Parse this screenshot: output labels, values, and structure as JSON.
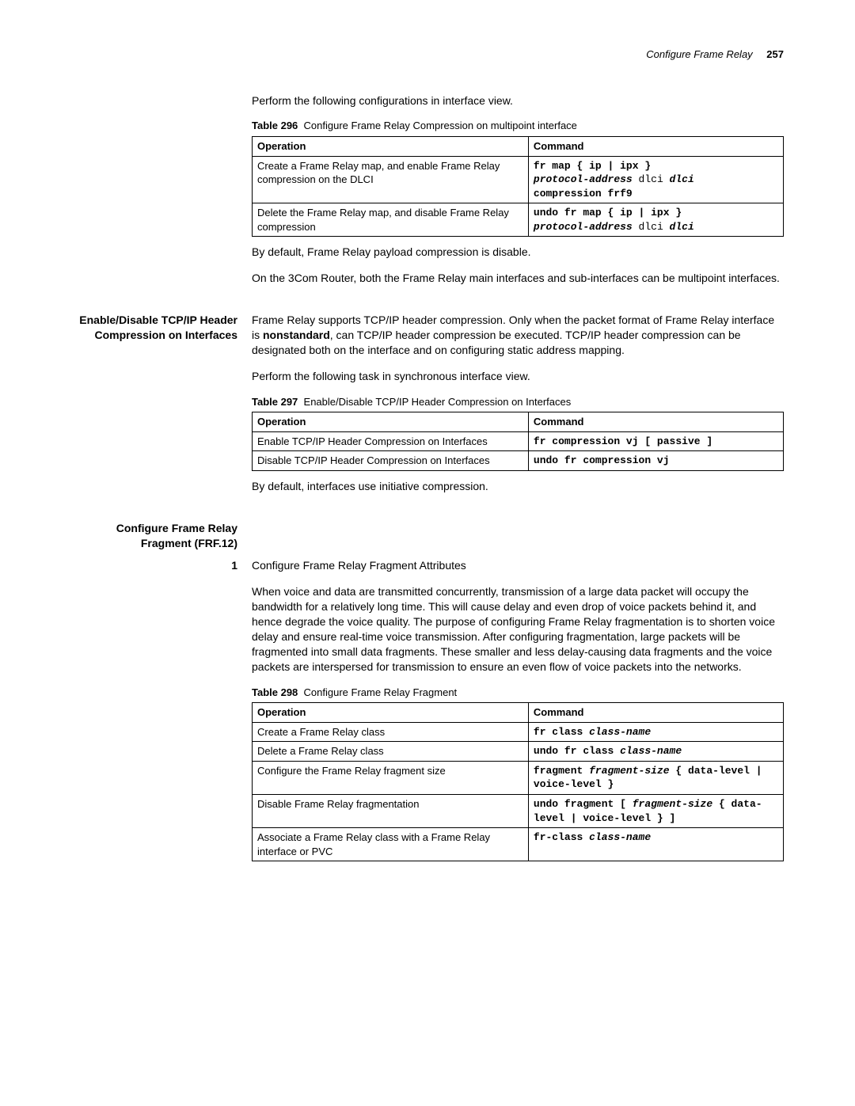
{
  "header": {
    "title": "Configure Frame Relay",
    "page": "257"
  },
  "intro1": "Perform the following configurations in interface view.",
  "table296": {
    "label": "Table 296",
    "caption": "Configure Frame Relay Compression on multipoint interface",
    "h1": "Operation",
    "h2": "Command",
    "r1op": "Create a Frame Relay map, and enable Frame Relay compression on the DLCI",
    "r1c_a": "fr map { ip | ipx }",
    "r1c_b": "protocol-address",
    "r1c_c": " dlci ",
    "r1c_d": "dlci",
    "r1c_e": "compression frf9",
    "r2op": "Delete the Frame Relay map, and disable Frame Relay compression",
    "r2c_a": "undo fr map { ip | ipx }",
    "r2c_b": "protocol-address",
    "r2c_c": " dlci ",
    "r2c_d": "dlci"
  },
  "afterT296a": "By default, Frame Relay payload compression is disable.",
  "afterT296b": "On the 3Com Router, both the Frame Relay main interfaces and sub-interfaces can be multipoint interfaces.",
  "sectionTCP": {
    "heading": "Enable/Disable TCP/IP Header Compression on Interfaces",
    "para1a": "Frame Relay supports TCP/IP header compression. Only when the packet format of Frame Relay interface is ",
    "para1b": "nonstandard",
    "para1c": ", can TCP/IP header compression be executed. TCP/IP header compression can be designated both on the interface and on configuring static address mapping.",
    "para2": "Perform the following task in synchronous interface view."
  },
  "table297": {
    "label": "Table 297",
    "caption": "Enable/Disable TCP/IP Header Compression on Interfaces",
    "h1": "Operation",
    "h2": "Command",
    "r1op": "Enable TCP/IP Header Compression on Interfaces",
    "r1c": "fr compression vj [ passive ]",
    "r2op": "Disable TCP/IP Header Compression on Interfaces",
    "r2c": "undo fr compression vj"
  },
  "afterT297": "By default, interfaces use initiative compression.",
  "sectionFRF": {
    "heading": "Configure Frame Relay Fragment (FRF.12)",
    "num": "1",
    "step1title": "Configure Frame Relay Fragment Attributes",
    "step1body": "When voice and data are transmitted concurrently, transmission of a large data packet will occupy the bandwidth for a relatively long time. This will cause delay and even drop of voice packets behind it, and hence degrade the voice quality. The purpose of configuring Frame Relay fragmentation is to shorten voice delay and ensure real-time voice transmission. After configuring fragmentation, large packets will be fragmented into small data fragments. These smaller and less delay-causing data fragments and the voice packets are interspersed for transmission to ensure an even flow of voice packets into the networks."
  },
  "table298": {
    "label": "Table 298",
    "caption": "Configure Frame Relay Fragment",
    "h1": "Operation",
    "h2": "Command",
    "r1op": "Create a Frame Relay class",
    "r1c_a": "fr class ",
    "r1c_b": "class-name",
    "r2op": "Delete a Frame Relay class",
    "r2c_a": "undo fr class ",
    "r2c_b": "class-name",
    "r3op": "Configure the Frame Relay fragment size",
    "r3c_a": "fragment ",
    "r3c_b": "fragment-size",
    "r3c_c": " { data-level | voice-level }",
    "r4op": "Disable Frame Relay fragmentation",
    "r4c_a": "undo fragment [ ",
    "r4c_b": "fragment-size",
    "r4c_c": " { data-level | voice-level } ]",
    "r5op": "Associate a Frame Relay class with a Frame Relay interface or PVC",
    "r5c_a": "fr-class ",
    "r5c_b": "class-name"
  }
}
